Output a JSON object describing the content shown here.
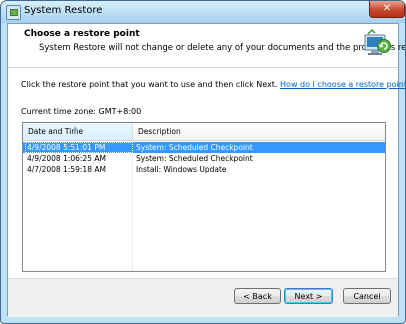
{
  "window": {
    "title": "System Restore",
    "close_glyph": "✕"
  },
  "header": {
    "title": "Choose a restore point",
    "subtitle": "System Restore will not change or delete any of your documents and the process is reversible.",
    "icon": "system-restore-icon"
  },
  "instruction": {
    "text": "Click the restore point that you want to use and then click Next.",
    "link": "How do I choose a restore point?"
  },
  "timezone": "Current time zone: GMT+8:00",
  "list": {
    "columns": [
      "Date and Time",
      "Description"
    ],
    "rows": [
      {
        "date": "4/9/2008 5:51:01 PM",
        "description": "System: Scheduled Checkpoint",
        "selected": true
      },
      {
        "date": "4/9/2008 1:06:25 AM",
        "description": "System: Scheduled Checkpoint",
        "selected": false
      },
      {
        "date": "4/7/2008 1:59:18 AM",
        "description": "Install: Windows Update",
        "selected": false
      }
    ]
  },
  "buttons": {
    "back": "< Back",
    "next": "Next >",
    "cancel": "Cancel"
  },
  "colors": {
    "selection": "#3399ff",
    "link": "#0066cc",
    "frame": "#bfe1f6"
  }
}
